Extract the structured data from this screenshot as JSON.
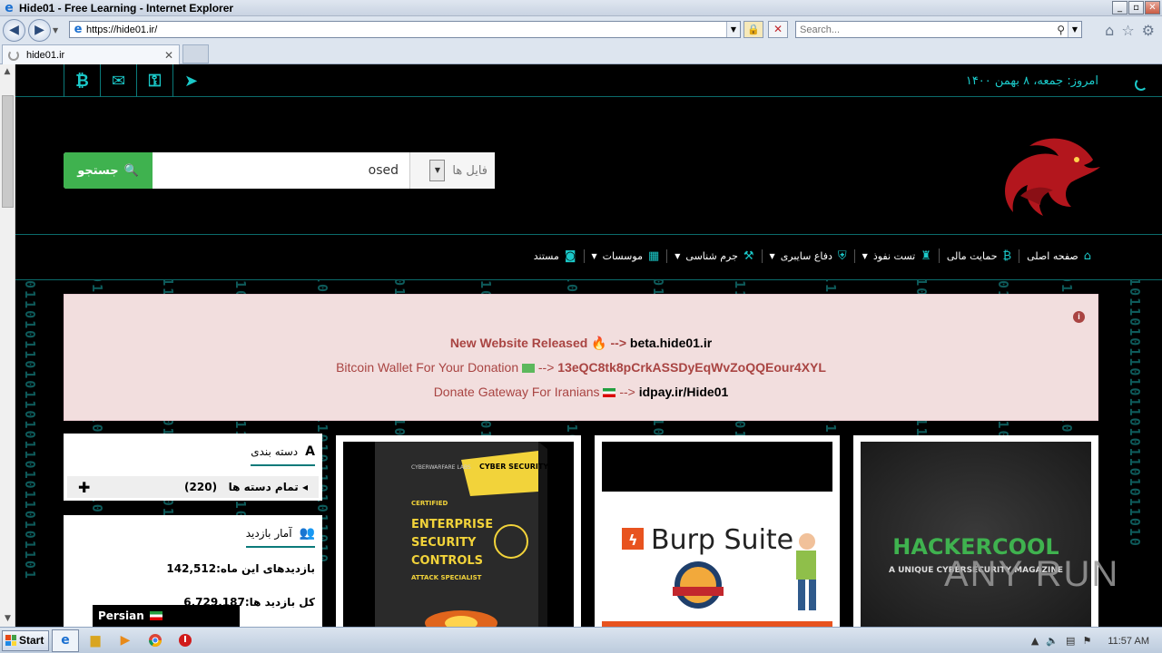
{
  "window": {
    "title": "Hide01 - Free Learning - Internet Explorer"
  },
  "browser": {
    "url": "https://hide01.ir/",
    "search_placeholder": "Search...",
    "tab_label": "hide01.ir"
  },
  "topbar": {
    "date": "امروز: جمعه، ۸ بهمن ۱۴۰۰"
  },
  "search": {
    "button_label": "جستجو",
    "query": "osed",
    "category": "فایل ها"
  },
  "menu": {
    "items": [
      {
        "label": "صفحه اصلی",
        "icon": "home-icon",
        "dropdown": false
      },
      {
        "label": "حمایت مالی",
        "icon": "bitcoin-icon",
        "dropdown": false
      },
      {
        "label": "تست نفوذ",
        "icon": "user-secret-icon",
        "dropdown": true
      },
      {
        "label": "دفاع سایبری",
        "icon": "shield-icon",
        "dropdown": true
      },
      {
        "label": "جرم شناسی",
        "icon": "gavel-icon",
        "dropdown": true
      },
      {
        "label": "موسسات",
        "icon": "building-icon",
        "dropdown": true
      },
      {
        "label": "مستند",
        "icon": "camera-icon",
        "dropdown": false
      }
    ]
  },
  "notice": {
    "line1_text": "New Website Released",
    "line1_sep": "-->",
    "line1_link": "beta.hide01.ir",
    "line2_text": "Bitcoin Wallet For Your Donation",
    "line2_sep": "-->",
    "line2_link": "13eQC8tk8pCrkASSDyEqWvZoQQEour4XYL",
    "line3_text": "Donate Gateway For Iranians",
    "line3_sep": "-->",
    "line3_link": "idpay.ir/Hide01"
  },
  "sidebar": {
    "categories_title": "دسته بندی",
    "all_categories_label": "تمام دسته ها",
    "all_categories_count": "(220)",
    "stats_title": "آمار بازدید",
    "month_visits": "بازدیدهای این ماه:142,512",
    "total_visits": "کل بازدید ها:6,729,187"
  },
  "language": {
    "label": "Persian"
  },
  "cards": [
    {
      "img_title": "ENTERPRISE SECURITY CONTROLS",
      "img_tag": "CYBER SECURITY ESSENTIALS",
      "img_sub": "ATTACK SPECIALIST",
      "img_badge": "CERTIFIED",
      "img_brand": "CYBERWARFARE LABS"
    },
    {
      "img_title": "Burp Suite"
    },
    {
      "img_title": "HACKERCOOL",
      "img_sub": "A UNIQUE CYBERSECURITY MAGAZINE"
    }
  ],
  "watermark": "ANY RUN",
  "taskbar": {
    "start_label": "Start",
    "clock": "11:57 AM"
  },
  "colors": {
    "accent": "#1bc9c9",
    "search_green": "#3fb24f",
    "notice_bg": "#f2dede",
    "notice_text": "#a94442"
  }
}
